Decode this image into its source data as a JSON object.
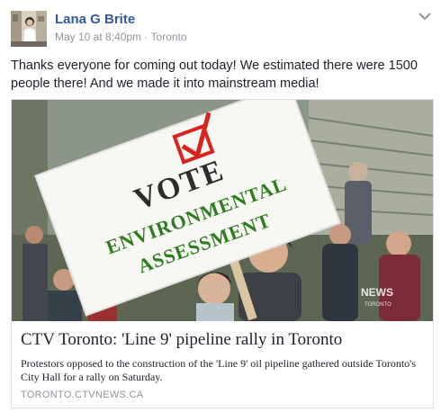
{
  "post": {
    "author": "Lana G Brite",
    "timestamp": "May 10 at 8:40pm",
    "separator": "·",
    "location": "Toronto",
    "text": "Thanks everyone for coming out today! We estimated there were 1500 people there! And we made it into mainstream media!"
  },
  "link": {
    "title": "CTV Toronto: 'Line 9' pipeline rally in Toronto",
    "description": "Protestors opposed to the construction of the 'Line 9' oil pipeline gathered outside Toronto's City Hall for a rally on Saturday.",
    "domain": "TORONTO.CTVNEWS.CA"
  },
  "image": {
    "sign_line1": "VOTE",
    "sign_line2": "ENVIRONMENTAL",
    "sign_line3": "ASSESSMENT",
    "watermark": "NEWS",
    "watermark_sub": "TORONTO"
  },
  "colors": {
    "author": "#365899",
    "meta": "#90949c",
    "sign_green": "#2e7d1f",
    "check_red": "#d9231d"
  },
  "icons": {
    "options": "chevron-down-icon"
  }
}
